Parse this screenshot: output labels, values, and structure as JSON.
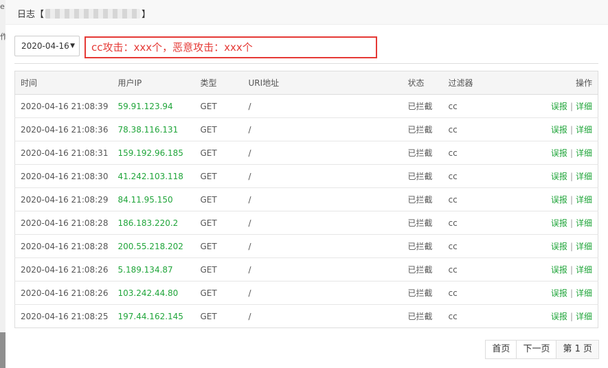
{
  "backdrop": {
    "chars": [
      "e",
      "作"
    ]
  },
  "dialog": {
    "title_prefix": "日志【",
    "title_suffix": "】"
  },
  "filter": {
    "date_value": "2020-04-16"
  },
  "note": "cc攻击：xxx个，恶意攻击：xxx个",
  "table": {
    "headers": {
      "time": "时间",
      "ip": "用户IP",
      "type": "类型",
      "uri": "URI地址",
      "status": "状态",
      "filter": "过滤器",
      "ops": "操作"
    },
    "rows": [
      {
        "time": "2020-04-16 21:08:39",
        "ip": "59.91.123.94",
        "type": "GET",
        "uri": "/",
        "status": "已拦截",
        "filter": "cc",
        "report": "误报",
        "sep": "|",
        "detail": "详细"
      },
      {
        "time": "2020-04-16 21:08:36",
        "ip": "78.38.116.131",
        "type": "GET",
        "uri": "/",
        "status": "已拦截",
        "filter": "cc",
        "report": "误报",
        "sep": "|",
        "detail": "详细"
      },
      {
        "time": "2020-04-16 21:08:31",
        "ip": "159.192.96.185",
        "type": "GET",
        "uri": "/",
        "status": "已拦截",
        "filter": "cc",
        "report": "误报",
        "sep": "|",
        "detail": "详细"
      },
      {
        "time": "2020-04-16 21:08:30",
        "ip": "41.242.103.118",
        "type": "GET",
        "uri": "/",
        "status": "已拦截",
        "filter": "cc",
        "report": "误报",
        "sep": "|",
        "detail": "详细"
      },
      {
        "time": "2020-04-16 21:08:29",
        "ip": "84.11.95.150",
        "type": "GET",
        "uri": "/",
        "status": "已拦截",
        "filter": "cc",
        "report": "误报",
        "sep": "|",
        "detail": "详细"
      },
      {
        "time": "2020-04-16 21:08:28",
        "ip": "186.183.220.2",
        "type": "GET",
        "uri": "/",
        "status": "已拦截",
        "filter": "cc",
        "report": "误报",
        "sep": "|",
        "detail": "详细"
      },
      {
        "time": "2020-04-16 21:08:28",
        "ip": "200.55.218.202",
        "type": "GET",
        "uri": "/",
        "status": "已拦截",
        "filter": "cc",
        "report": "误报",
        "sep": "|",
        "detail": "详细"
      },
      {
        "time": "2020-04-16 21:08:26",
        "ip": "5.189.134.87",
        "type": "GET",
        "uri": "/",
        "status": "已拦截",
        "filter": "cc",
        "report": "误报",
        "sep": "|",
        "detail": "详细"
      },
      {
        "time": "2020-04-16 21:08:26",
        "ip": "103.242.44.80",
        "type": "GET",
        "uri": "/",
        "status": "已拦截",
        "filter": "cc",
        "report": "误报",
        "sep": "|",
        "detail": "详细"
      },
      {
        "time": "2020-04-16 21:08:25",
        "ip": "197.44.162.145",
        "type": "GET",
        "uri": "/",
        "status": "已拦截",
        "filter": "cc",
        "report": "误报",
        "sep": "|",
        "detail": "详细"
      }
    ]
  },
  "pagination": {
    "first": "首页",
    "next": "下一页",
    "current": "第 1 页"
  },
  "colors": {
    "accent_green": "#20a53a",
    "highlight_red": "#e53935"
  }
}
